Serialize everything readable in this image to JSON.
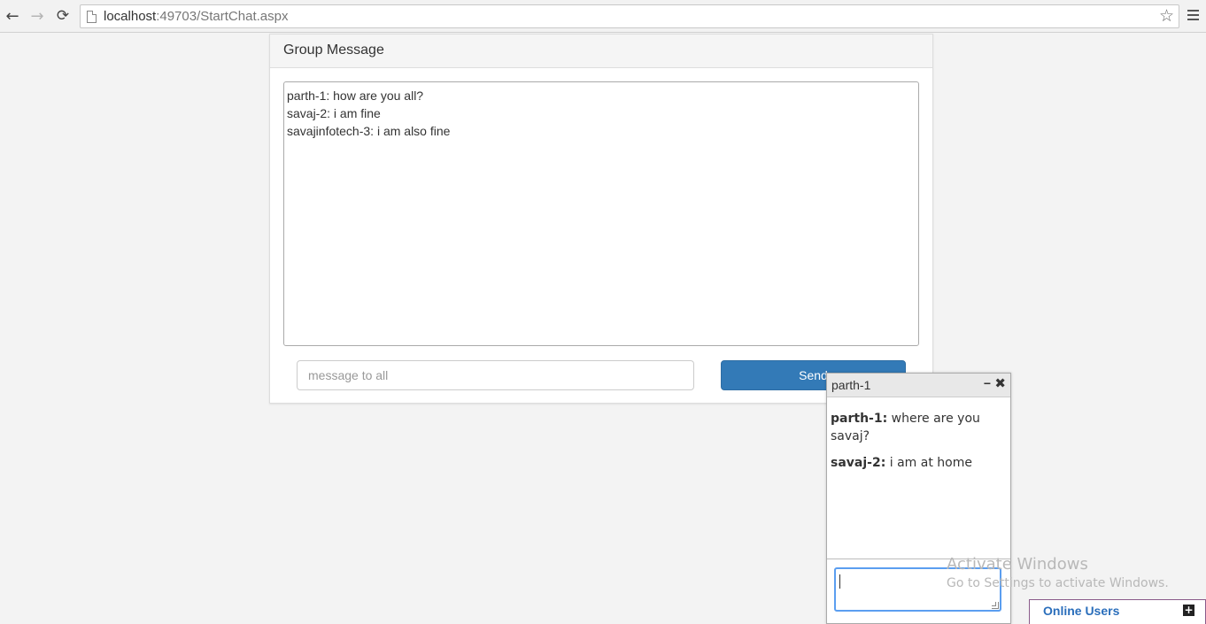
{
  "browser": {
    "url_host": "localhost",
    "url_path": ":49703/StartChat.aspx",
    "back_icon": "←",
    "forward_icon": "→",
    "reload_icon": "⟳",
    "star_icon": "☆"
  },
  "group_panel": {
    "title": "Group Message",
    "messages": [
      "parth-1: how are you all?",
      "savaj-2: i am fine",
      "savajinfotech-3: i am also fine"
    ],
    "input_placeholder": "message to all",
    "send_label": "Send"
  },
  "private_chat": {
    "title": "parth-1",
    "minimize_icon": "−",
    "close_icon": "✖",
    "messages": [
      {
        "sender": "parth-1:",
        "text": " where are you savaj?"
      },
      {
        "sender": "savaj-2:",
        "text": " i am at home"
      }
    ]
  },
  "watermark": {
    "line1": "Activate Windows",
    "line2": "Go to Settings to activate Windows."
  },
  "online_users": {
    "label": "Online Users",
    "plus_icon": "+"
  },
  "colors": {
    "accent": "#337ab7",
    "online_label": "#2a6ebb",
    "focus_border": "#5b9ef0"
  }
}
